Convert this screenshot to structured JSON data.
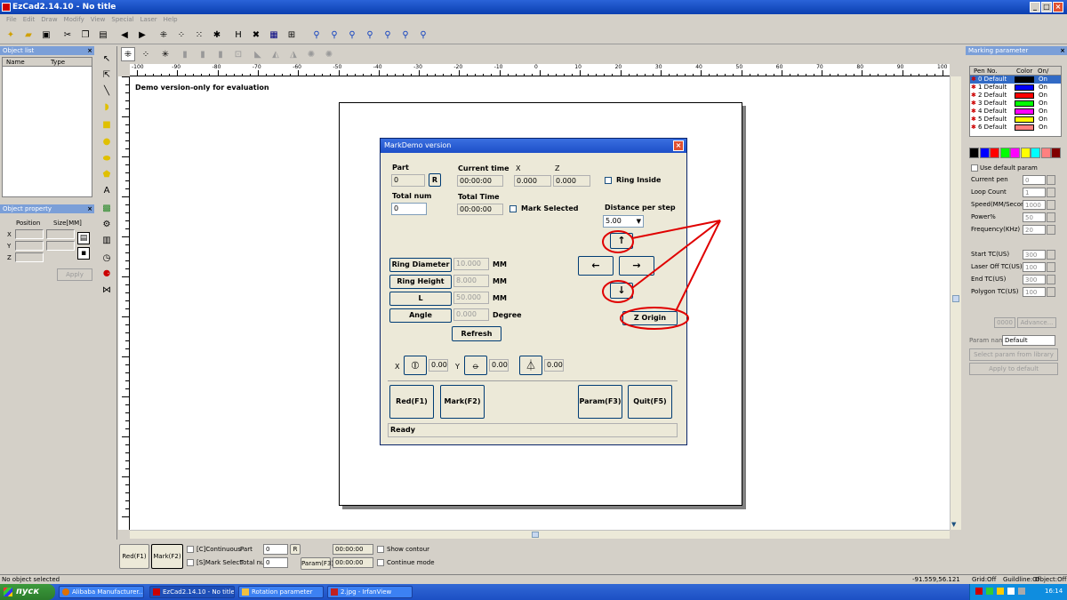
{
  "window": {
    "title": "EzCad2.14.10 - No title"
  },
  "menu": [
    "File",
    "Edit",
    "Draw",
    "Modify",
    "View",
    "Special",
    "Laser",
    "Help"
  ],
  "object_list": {
    "title": "Object list",
    "col_name": "Name",
    "col_type": "Type"
  },
  "object_property": {
    "title": "Object property",
    "position": "Position",
    "size": "Size[MM]",
    "x": "X",
    "y": "Y",
    "z": "Z",
    "apply": "Apply"
  },
  "ruler": {
    "ticks": [
      "-100",
      "-90",
      "-80",
      "-70",
      "-60",
      "-50",
      "-40",
      "-30",
      "-20",
      "-10",
      "0",
      "10",
      "20",
      "30",
      "40",
      "50",
      "60",
      "70",
      "80",
      "90",
      "100"
    ]
  },
  "canvas": {
    "demo_text": "Demo version-only for evaluation"
  },
  "dialog": {
    "title": "MarkDemo version",
    "part_label": "Part",
    "part_value": "0",
    "reset": "R",
    "total_num_label": "Total num",
    "total_num_value": "0",
    "current_time_label": "Current time",
    "current_time_value": "00:00:00",
    "total_time_label": "Total Time",
    "total_time_value": "00:00:00",
    "x_label": "X",
    "x_value": "0.000",
    "z_label": "Z",
    "z_value": "0.000",
    "ring_inside": "Ring Inside",
    "mark_selected": "Mark Selected",
    "distance_label": "Distance per step",
    "distance_value": "5.00",
    "ring_diameter": "Ring Diameter",
    "ring_diameter_value": "10.000",
    "ring_height": "Ring Height",
    "ring_height_value": "8.000",
    "l": "L",
    "l_value": "50.000",
    "angle": "Angle",
    "angle_value": "0.000",
    "unit_mm": "MM",
    "unit_degree": "Degree",
    "refresh": "Refresh",
    "up": "↑",
    "down": "↓",
    "left": "←",
    "right": "→",
    "z_origin": "Z Origin",
    "rx_label": "X",
    "rx_value": "0.00",
    "ry_label": "Y",
    "ry_value": "0.00",
    "rz_value": "0.00",
    "red": "Red(F1)",
    "mark": "Mark(F2)",
    "param": "Param(F3)",
    "quit": "Quit(F5)",
    "status": "Ready"
  },
  "bottom": {
    "red": "Red(F1)",
    "mark": "Mark(F2)",
    "continuous": "[C]Continuous",
    "mark_select": "[S]Mark Select",
    "part_label": "Part",
    "part_value": "0",
    "total_label": "Total nu",
    "total_value": "0",
    "reset": "R",
    "time1": "00:00:00",
    "time2": "00:00:00",
    "param": "Param(F3)",
    "show_contour": "Show contour",
    "continue_mode": "Continue mode"
  },
  "status": {
    "left": "No object selected",
    "coords": "-91.559,56.121",
    "grid": "Grid:Off",
    "guideline": "Guildline:Of",
    "object": "Object:Off"
  },
  "marking": {
    "title": "Marking parameter",
    "col_pen": "Pen No.",
    "col_color": "Color",
    "col_on": "On/",
    "pens": [
      {
        "name": "0 Default",
        "color": "#000000",
        "on": "On"
      },
      {
        "name": "1 Default",
        "color": "#0000ff",
        "on": "On"
      },
      {
        "name": "2 Default",
        "color": "#ff0000",
        "on": "On"
      },
      {
        "name": "3 Default",
        "color": "#00ff00",
        "on": "On"
      },
      {
        "name": "4 Default",
        "color": "#ff00ff",
        "on": "On"
      },
      {
        "name": "5 Default",
        "color": "#ffff00",
        "on": "On"
      },
      {
        "name": "6 Default",
        "color": "#ff8080",
        "on": "On"
      }
    ],
    "palette": [
      "#000000",
      "#0000ff",
      "#ff0000",
      "#00ff00",
      "#ff00ff",
      "#ffff00",
      "#00ffff",
      "#ff8080",
      "#800000"
    ],
    "use_default": "Use default param",
    "params": [
      {
        "label": "Current pen",
        "value": "0"
      },
      {
        "label": "Loop Count",
        "value": "1"
      },
      {
        "label": "Speed(MM/Secon",
        "value": "1000"
      },
      {
        "label": "Power%",
        "value": "50"
      },
      {
        "label": "Frequency(KHz)",
        "value": "20"
      },
      {
        "label": "Start TC(US)",
        "value": "300"
      },
      {
        "label": "Laser Off TC(US)",
        "value": "100"
      },
      {
        "label": "End TC(US)",
        "value": "300"
      },
      {
        "label": "Polygon TC(US)",
        "value": "100"
      }
    ],
    "advance": "Advance...",
    "small_btn": "0000",
    "param_name_label": "Param name",
    "param_name_value": "Default",
    "select_library": "Select param from library",
    "apply_default": "Apply to default"
  },
  "taskbar": {
    "start": "пуск",
    "tasks": [
      "Alibaba Manufacturer...",
      "EzCad2.14.10 - No title",
      "Rotation parameter",
      "2.jpg - IrfanView"
    ],
    "time": "16:14"
  },
  "colors": {
    "annotation": "#e00000",
    "titlebar": "#0a3fb0",
    "taskbar": "#2456c8"
  }
}
